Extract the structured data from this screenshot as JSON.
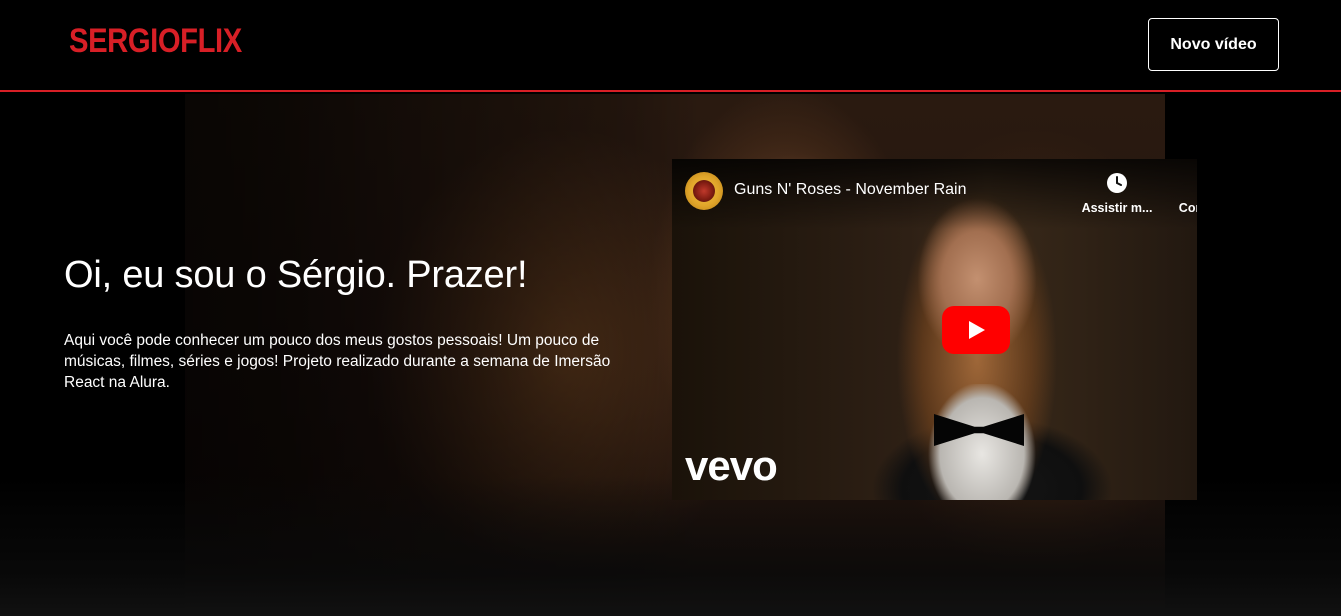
{
  "header": {
    "logo_text": "SERGIOFLIX",
    "new_video_label": "Novo vídeo",
    "accent_color": "#d81f26"
  },
  "banner": {
    "title": "Oi, eu sou o Sérgio. Prazer!",
    "description": "Aqui você pode conhecer um pouco dos meus gostos pessoais! Um pouco de músicas, filmes, séries e jogos! Projeto realizado durante a semana de Imersão React na Alura."
  },
  "video": {
    "title": "Guns N' Roses - November Rain",
    "watch_later_label": "Assistir m...",
    "share_label": "Compartilh...",
    "watermark": "vevo",
    "icons": {
      "watch_later": "clock-icon",
      "share": "share-arrow-icon",
      "play": "play-icon",
      "channel": "channel-avatar"
    },
    "play_color": "#ff0000"
  }
}
